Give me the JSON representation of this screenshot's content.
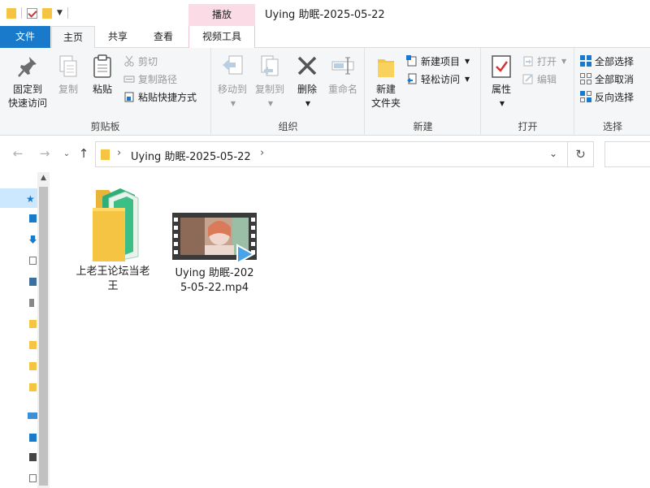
{
  "window": {
    "title": "Uying 助眠-2025-05-22",
    "context_tab_header": "播放"
  },
  "tabs": {
    "file": "文件",
    "home": "主页",
    "share": "共享",
    "view": "查看",
    "video_tools": "视频工具"
  },
  "ribbon": {
    "clipboard": {
      "label": "剪贴板",
      "pin_line1": "固定到",
      "pin_line2": "快速访问",
      "copy": "复制",
      "paste": "粘贴",
      "cut": "剪切",
      "copy_path": "复制路径",
      "paste_shortcut": "粘贴快捷方式"
    },
    "organize": {
      "label": "组织",
      "move_to": "移动到",
      "copy_to": "复制到",
      "delete": "删除",
      "rename": "重命名"
    },
    "new": {
      "label": "新建",
      "new_folder_line1": "新建",
      "new_folder_line2": "文件夹",
      "new_item": "新建项目",
      "easy_access": "轻松访问"
    },
    "open": {
      "label": "打开",
      "properties": "属性",
      "open": "打开",
      "edit": "编辑"
    },
    "select": {
      "label": "选择",
      "select_all": "全部选择",
      "select_none": "全部取消",
      "invert": "反向选择"
    }
  },
  "address": {
    "crumb": "Uying 助眠-2025-05-22"
  },
  "files": [
    {
      "name": "上老王论坛当老王",
      "type": "folder"
    },
    {
      "name": "Uying 助眠-2025-05-22.mp4",
      "type": "video"
    }
  ],
  "colors": {
    "accent": "#1979ca",
    "context_tab": "#fadbe6",
    "folder": "#f6c443",
    "selection": "#cce8ff"
  }
}
